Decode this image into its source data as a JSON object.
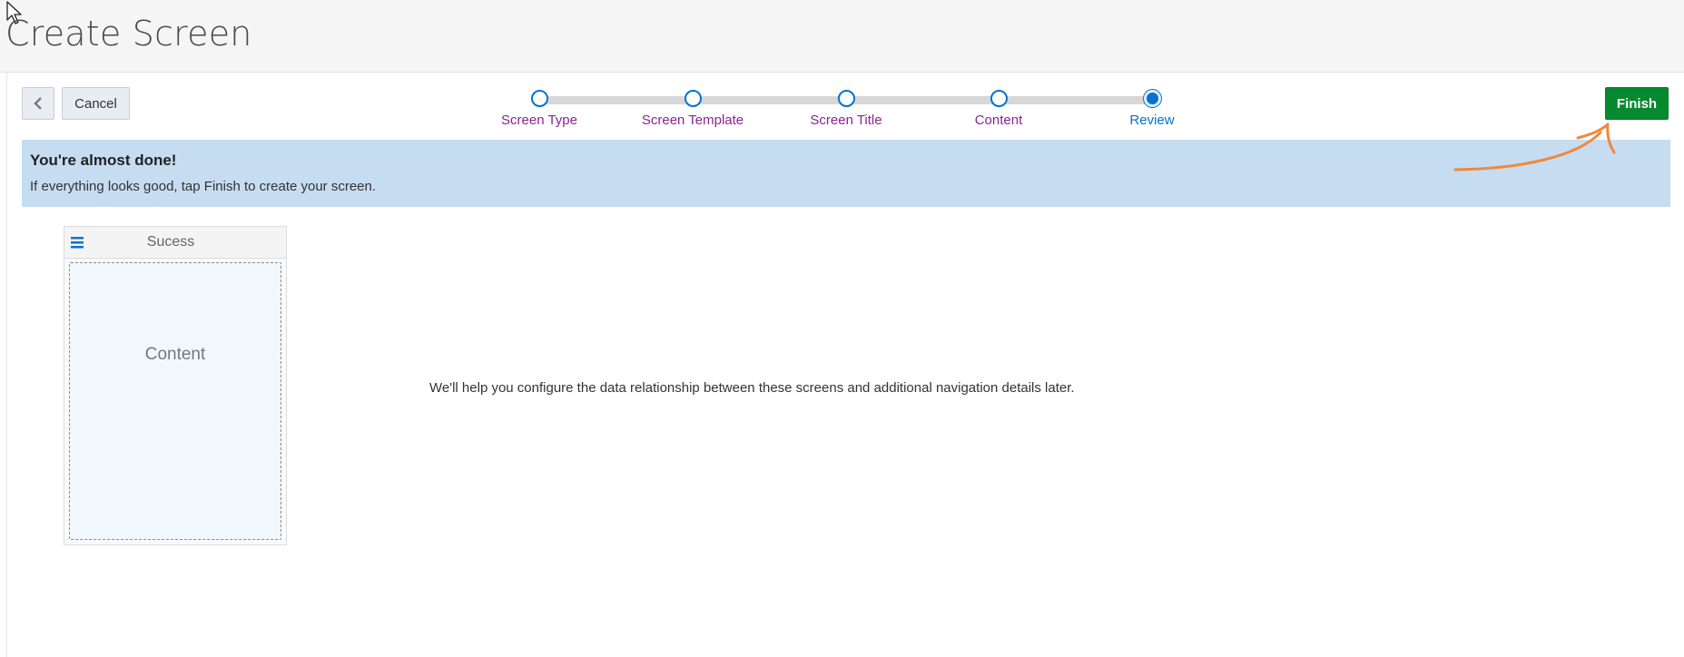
{
  "header": {
    "title": "Create Screen"
  },
  "toolbar": {
    "back_icon": "chevron-left-icon",
    "cancel_label": "Cancel",
    "finish_label": "Finish"
  },
  "train": {
    "steps": [
      {
        "label": "Screen Type"
      },
      {
        "label": "Screen Template"
      },
      {
        "label": "Screen Title"
      },
      {
        "label": "Content"
      },
      {
        "label": "Review"
      }
    ],
    "active_index": 4,
    "colors": {
      "visited": "#8a2593",
      "active": "#0572ce"
    }
  },
  "banner": {
    "title": "You're almost done!",
    "text": "If everything looks good, tap Finish to create your screen."
  },
  "preview": {
    "screen_title": "Sucess",
    "content_label": "Content",
    "menu_icon": "hamburger-menu-icon"
  },
  "info": {
    "text": "We'll help you configure the data relationship between these screens and additional navigation details later."
  },
  "colors": {
    "finish": "#078930",
    "banner": "#c6dcf1",
    "annotation_arrow": "#f0883e"
  }
}
